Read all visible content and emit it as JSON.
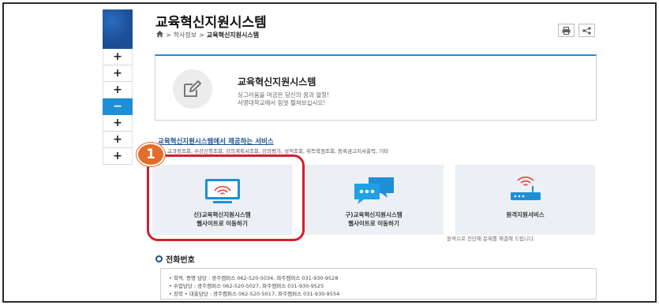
{
  "page": {
    "title": "교육혁신지원시스템",
    "breadcrumb": {
      "separator": ">",
      "parent": "학사정보",
      "current": "교육혁신지원시스템"
    }
  },
  "sidebar": {
    "buttons": [
      {
        "symbol": "+",
        "active": false
      },
      {
        "symbol": "+",
        "active": false
      },
      {
        "symbol": "+",
        "active": false
      },
      {
        "symbol": "−",
        "active": true
      },
      {
        "symbol": "+",
        "active": false
      },
      {
        "symbol": "+",
        "active": false
      },
      {
        "symbol": "+",
        "active": false
      }
    ]
  },
  "toolbar": {
    "print_icon": "print-icon",
    "share_icon": "share-icon"
  },
  "intro": {
    "icon": "edit-icon",
    "title": "교육혁신지원시스템",
    "desc_line1": "싱그러움을 머금은 당신의 꿈과 열정!",
    "desc_line2": "서영대학교에서 힘껏 펼쳐보십시오!"
  },
  "services": {
    "heading": "교육혁신지원시스템에서 제공하는 서비스",
    "list": "교과정조회, 수강신청조회, 강의계획서조회, 강의평가, 성적조회, 취득학점조회, 등록금고지서출력, 기타",
    "cards": [
      {
        "icon": "monitor-wifi-icon",
        "line1": "신)교육혁신지원시스템",
        "line2": "웹사이트로 이동하기"
      },
      {
        "icon": "chat-bubbles-icon",
        "line1": "구)교육혁신지원시스템",
        "line2": "웹사이트로 이동하기"
      },
      {
        "icon": "router-icon",
        "line1": "원격지원서비스",
        "line2": ""
      }
    ],
    "remote_note": "원격으로 진단해 문제를 해결해 드립니다."
  },
  "annotation": {
    "step_number": "1"
  },
  "phone": {
    "title": "전화번호",
    "lines": [
      "• 학적, 증명 담당 : 광주캠퍼스 062-520-5034, 파주캠퍼스 031-930-9528",
      "• 수업담당 : 광주캠퍼스 062-520-5027, 파주캠퍼스 031-930-9525",
      "• 장학 • 대출담당 : 광주캠퍼스 062-520-5017, 파주캠퍼스 031-930-9554"
    ]
  },
  "colors": {
    "accent": "#1d8fd6",
    "highlight": "#d4202a",
    "badge": "#e46c2a",
    "card_bg": "#eceff3",
    "link": "#1a4f93"
  }
}
